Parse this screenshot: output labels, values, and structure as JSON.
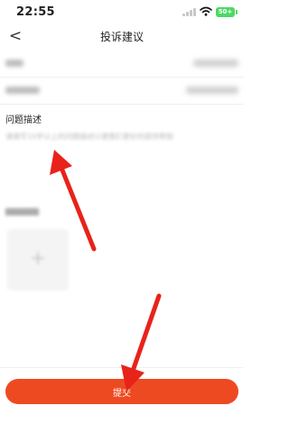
{
  "status_bar": {
    "time": "22:55",
    "battery": "50+"
  },
  "header": {
    "back_symbol": "<",
    "title": "投诉建议"
  },
  "form": {
    "description_label": "问题描述",
    "description_placeholder": "请填写10字以上的问题描述以便我们更好的提供帮助",
    "description_value": ""
  },
  "submit_label": "提交",
  "colors": {
    "accent": "#ee4a22",
    "annotation_arrow": "#e8231a",
    "battery": "#4cd964"
  }
}
